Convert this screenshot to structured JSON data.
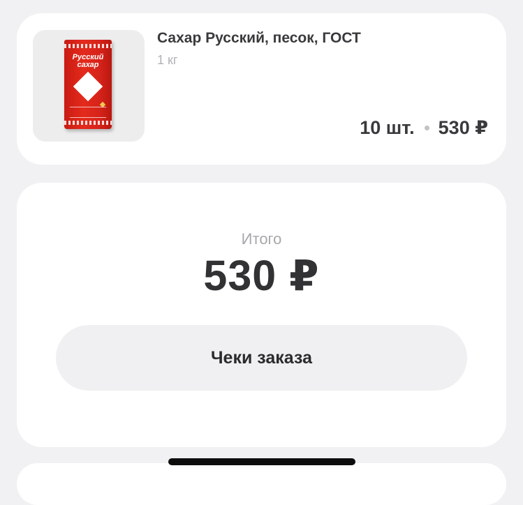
{
  "product": {
    "name": "Сахар Русский, песок, ГОСТ",
    "weight": "1 кг",
    "quantity": "10 шт.",
    "price": "530 ₽",
    "image_icon": "sugar-package-image",
    "pack_text": "Русский сахар"
  },
  "summary": {
    "label": "Итого",
    "amount": "530 ₽"
  },
  "actions": {
    "receipts_label": "Чеки заказа"
  },
  "colors": {
    "background": "#f1f1f3",
    "card": "#ffffff",
    "button": "#f0f0f2",
    "pack_red": "#e42a1c"
  }
}
